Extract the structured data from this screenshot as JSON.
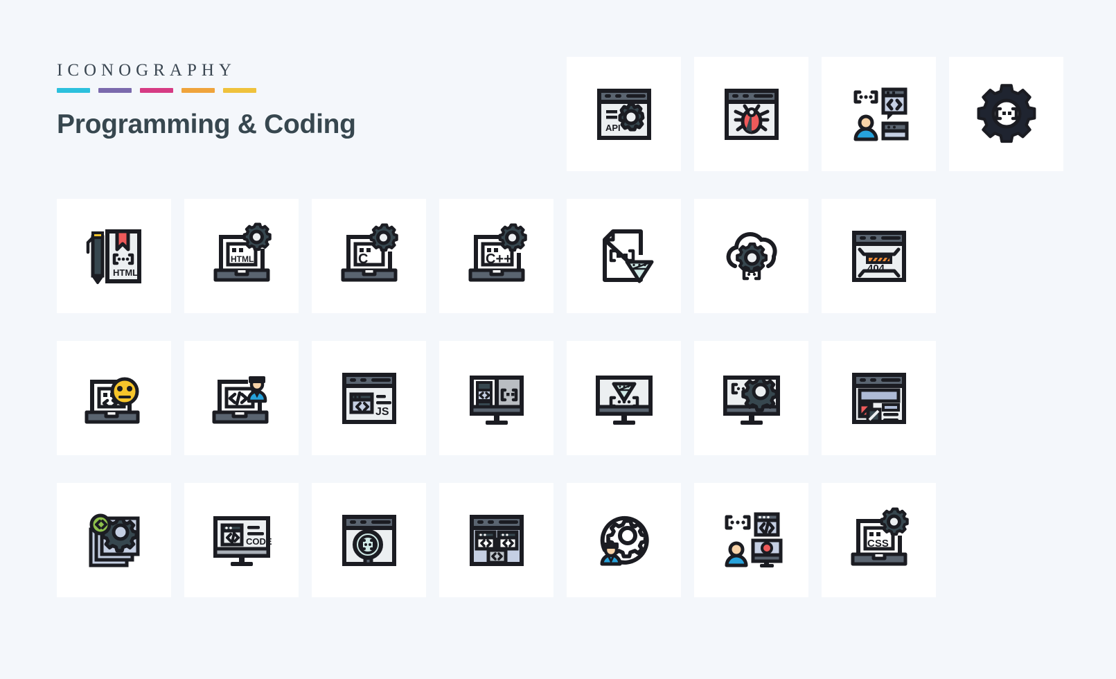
{
  "header": {
    "kicker": "ICONOGRAPHY",
    "title": "Programming & Coding",
    "accent_bars": [
      {
        "name": "bar-cyan",
        "color": "#2cc0dd"
      },
      {
        "name": "bar-purple",
        "color": "#7b6aad"
      },
      {
        "name": "bar-magenta",
        "color": "#d63b84"
      },
      {
        "name": "bar-orange",
        "color": "#efa43c"
      },
      {
        "name": "bar-yellow",
        "color": "#efc23c"
      }
    ]
  },
  "palette": {
    "background": "#f4f7fb",
    "tile": "#ffffff",
    "outline": "#1b1c22",
    "dark_slate": "#37474f",
    "steel": "#5a6470",
    "light_screen": "#eceff1",
    "pale_blue": "#c5cfe3",
    "red": "#ef5a5a",
    "yellow": "#f7c52b",
    "orange": "#f08b35",
    "blue": "#27a2db",
    "skin": "#f8d3a8",
    "green": "#8ec04b",
    "mint": "#cfe9e6",
    "title_text": "#37474f"
  },
  "grid": {
    "columns": 8,
    "rows": 4,
    "icon_count": 25,
    "icons": [
      {
        "row": 1,
        "col": 1,
        "name": "empty-cell",
        "label": ""
      },
      {
        "row": 1,
        "col": 2,
        "name": "empty-cell",
        "label": ""
      },
      {
        "row": 1,
        "col": 3,
        "name": "empty-cell",
        "label": ""
      },
      {
        "row": 1,
        "col": 4,
        "name": "empty-cell",
        "label": ""
      },
      {
        "row": 1,
        "col": 5,
        "name": "api-settings-browser-icon",
        "label": "API"
      },
      {
        "row": 1,
        "col": 6,
        "name": "bug-browser-icon",
        "label": ""
      },
      {
        "row": 1,
        "col": 7,
        "name": "developer-code-chat-icon",
        "label": ""
      },
      {
        "row": 1,
        "col": 8,
        "name": "gear-code-brackets-icon",
        "label": ""
      },
      {
        "row": 2,
        "col": 1,
        "name": "html-document-pencil-icon",
        "label": "HTML"
      },
      {
        "row": 2,
        "col": 2,
        "name": "html-laptop-settings-icon",
        "label": "HTML"
      },
      {
        "row": 2,
        "col": 3,
        "name": "c-laptop-settings-icon",
        "label": "C"
      },
      {
        "row": 2,
        "col": 4,
        "name": "cpp-laptop-settings-icon",
        "label": "C++"
      },
      {
        "row": 2,
        "col": 5,
        "name": "ruby-code-file-icon",
        "label": ""
      },
      {
        "row": 2,
        "col": 6,
        "name": "cloud-gear-code-icon",
        "label": ""
      },
      {
        "row": 2,
        "col": 7,
        "name": "error-404-browser-icon",
        "label": "404"
      },
      {
        "row": 2,
        "col": 8,
        "name": "empty-cell",
        "label": ""
      },
      {
        "row": 3,
        "col": 1,
        "name": "emoji-laptop-code-icon",
        "label": ""
      },
      {
        "row": 3,
        "col": 2,
        "name": "developer-laptop-code-icon",
        "label": ""
      },
      {
        "row": 3,
        "col": 3,
        "name": "javascript-browser-icon",
        "label": "JS"
      },
      {
        "row": 3,
        "col": 4,
        "name": "monitor-code-split-icon",
        "label": ""
      },
      {
        "row": 3,
        "col": 5,
        "name": "ruby-monitor-code-icon",
        "label": ""
      },
      {
        "row": 3,
        "col": 6,
        "name": "monitor-gear-code-icon",
        "label": ""
      },
      {
        "row": 3,
        "col": 7,
        "name": "broken-image-browser-icon",
        "label": ""
      },
      {
        "row": 3,
        "col": 8,
        "name": "empty-cell",
        "label": ""
      },
      {
        "row": 4,
        "col": 1,
        "name": "document-stack-gear-icon",
        "label": ""
      },
      {
        "row": 4,
        "col": 2,
        "name": "code-monitor-icon",
        "label": "CODE"
      },
      {
        "row": 4,
        "col": 3,
        "name": "search-code-browser-icon",
        "label": ""
      },
      {
        "row": 4,
        "col": 4,
        "name": "sitemap-code-browser-icon",
        "label": ""
      },
      {
        "row": 4,
        "col": 5,
        "name": "developer-gear-circle-icon",
        "label": ""
      },
      {
        "row": 4,
        "col": 6,
        "name": "developer-monitor-code-icon",
        "label": ""
      },
      {
        "row": 4,
        "col": 7,
        "name": "css-laptop-settings-icon",
        "label": "CSS"
      },
      {
        "row": 4,
        "col": 8,
        "name": "empty-cell",
        "label": ""
      }
    ],
    "icon_text_labels": {
      "api": "API",
      "html": "HTML",
      "c": "C",
      "cpp": "C++",
      "error404": "404",
      "js": "JS",
      "code": "CODE",
      "css": "CSS"
    }
  }
}
